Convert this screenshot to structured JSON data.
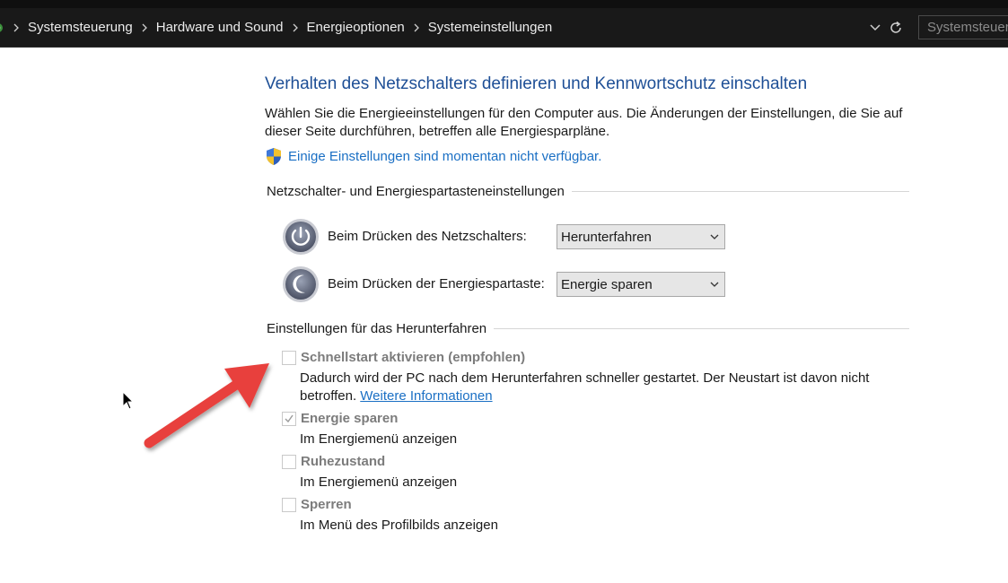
{
  "address_bar": {
    "breadcrumbs": [
      "Systemsteuerung",
      "Hardware und Sound",
      "Energieoptionen",
      "Systemeinstellungen"
    ],
    "search_placeholder": "Systemsteuerung durchsuchen",
    "icons": [
      "control-panel-icon",
      "chevron-down-icon",
      "refresh-icon"
    ]
  },
  "page": {
    "title": "Verhalten des Netzschalters definieren und Kennwortschutz einschalten",
    "description": "Wählen Sie die Energieeinstellungen für den Computer aus. Die Änderungen der Einstellungen, die Sie auf dieser Seite durchführen, betreffen alle Energiesparpläne.",
    "uac_link": "Einige Einstellungen sind momentan nicht verfügbar."
  },
  "power_buttons": {
    "heading": "Netzschalter- und Energiespartasteneinstellungen",
    "rows": [
      {
        "label": "Beim Drücken des Netzschalters:",
        "value": "Herunterfahren",
        "icon": "power-button-icon"
      },
      {
        "label": "Beim Drücken der Energiespartaste:",
        "value": "Energie sparen",
        "icon": "sleep-button-icon"
      }
    ]
  },
  "shutdown": {
    "heading": "Einstellungen für das Herunterfahren",
    "options": [
      {
        "title": "Schnellstart aktivieren (empfohlen)",
        "checked": false,
        "desc_line1": "Dadurch wird der PC nach dem Herunterfahren schneller gestartet. Der Neustart ist davon nicht",
        "desc_line2": "betroffen.",
        "link": "Weitere Informationen"
      },
      {
        "title": "Energie sparen",
        "checked": true,
        "desc_line1": "Im Energiemenü anzeigen"
      },
      {
        "title": "Ruhezustand",
        "checked": false,
        "desc_line1": "Im Energiemenü anzeigen"
      },
      {
        "title": "Sperren",
        "checked": false,
        "desc_line1": "Im Menü des Profilbilds anzeigen"
      }
    ]
  },
  "colors": {
    "title_blue": "#1e4f96",
    "link_blue": "#1a6fc4",
    "address_bar_bg": "#191919",
    "annotation_arrow": "#e8413c"
  }
}
